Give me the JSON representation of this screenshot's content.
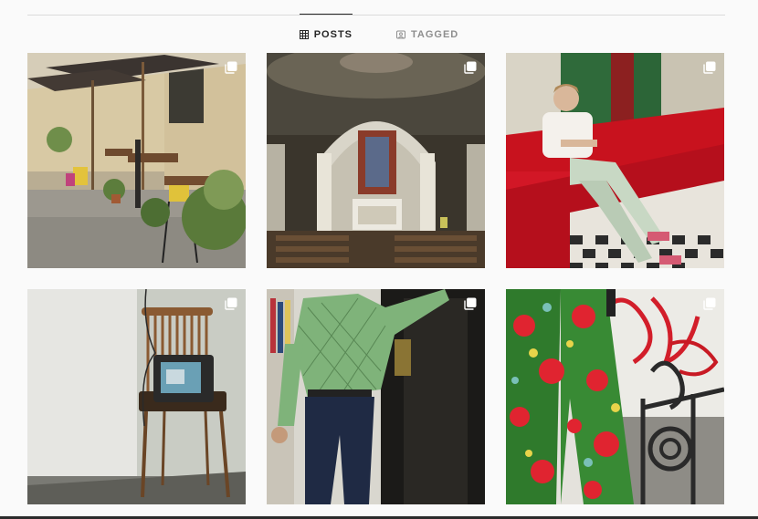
{
  "tabs": [
    {
      "label": "POSTS",
      "icon": "grid-icon",
      "active": true
    },
    {
      "label": "TAGGED",
      "icon": "tag-icon",
      "active": false
    }
  ],
  "posts": [
    {
      "id": "street-cafe",
      "multiple": true
    },
    {
      "id": "church-altar",
      "multiple": true
    },
    {
      "id": "red-seats",
      "multiple": true
    },
    {
      "id": "tv-chair",
      "multiple": true
    },
    {
      "id": "green-knit",
      "multiple": true
    },
    {
      "id": "floral-pants",
      "multiple": true
    }
  ],
  "colors": {
    "text_active": "#262626",
    "text_muted": "#8e8e8e",
    "divider": "#dbdbdb",
    "background": "#fafafa"
  }
}
